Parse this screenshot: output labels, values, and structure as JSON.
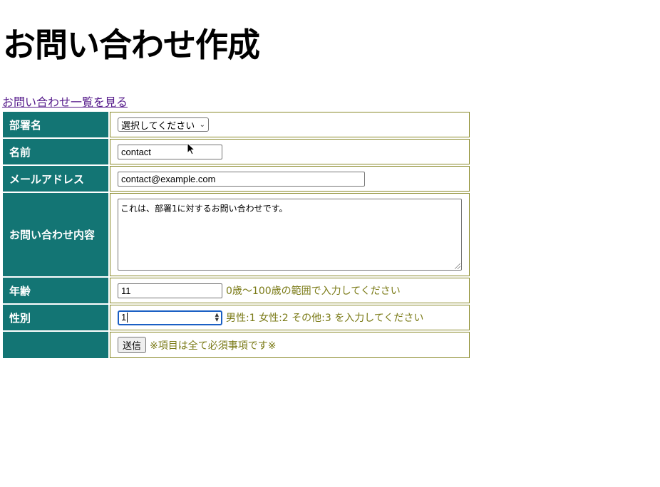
{
  "page": {
    "title": "お問い合わせ作成",
    "list_link": "お問い合わせ一覧を見る"
  },
  "form": {
    "department": {
      "label": "部署名",
      "selected": "選択してください"
    },
    "name": {
      "label": "名前",
      "value": "contact"
    },
    "email": {
      "label": "メールアドレス",
      "value": "contact@example.com"
    },
    "content": {
      "label": "お問い合わせ内容",
      "value": "これは、部署1に対するお問い合わせです。"
    },
    "age": {
      "label": "年齢",
      "value": "11",
      "hint": "0歳〜100歳の範囲で入力してください"
    },
    "gender": {
      "label": "性別",
      "value": "1",
      "hint": "男性:1 女性:2 その他:3 を入力してください"
    },
    "submit": {
      "label": "送信",
      "note": "※項目は全て必須事項です※"
    }
  },
  "colors": {
    "header_bg": "#137574",
    "cell_border": "#8a8a2a",
    "hint_text": "#7a7a16",
    "link": "#551a8b",
    "focus": "#1a5fc4"
  },
  "icons": {
    "select_chevron": "chevron-down-icon",
    "mouse_cursor": "mouse-pointer-icon"
  }
}
